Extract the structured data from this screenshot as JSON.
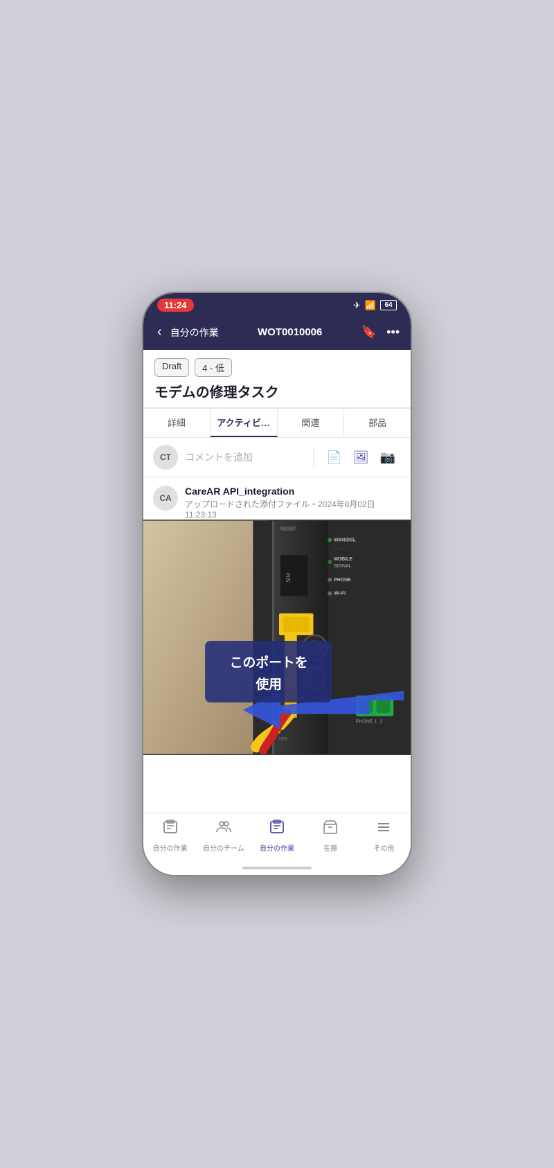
{
  "statusBar": {
    "time": "11:24",
    "batteryLevel": "64"
  },
  "navBar": {
    "backLabel": "自分の作業",
    "workOrderId": "WOT0010006"
  },
  "header": {
    "statusBadge": "Draft",
    "priorityBadge": "4 - 低",
    "title": "モデムの修理タスク"
  },
  "tabs": [
    {
      "label": "詳細",
      "active": false
    },
    {
      "label": "アクティビ…",
      "active": true
    },
    {
      "label": "関連",
      "active": false
    },
    {
      "label": "部品",
      "active": false
    }
  ],
  "commentArea": {
    "avatarText": "CT",
    "placeholder": "コメントを追加"
  },
  "activityItem": {
    "avatarText": "CA",
    "author": "CareAR API_integration",
    "meta": "アップロードされた添付ファイル・2024年8月02日 11:23:13"
  },
  "annotation": {
    "line1": "このポートを",
    "line2": "使用"
  },
  "bottomNav": [
    {
      "label": "自分の作業",
      "icon": "🗂",
      "active": false
    },
    {
      "label": "自分のチーム",
      "icon": "👥",
      "active": false
    },
    {
      "label": "自分の作業",
      "icon": "🗂",
      "active": true
    },
    {
      "label": "在庫",
      "icon": "📦",
      "active": false
    },
    {
      "label": "その他",
      "icon": "☰",
      "active": false
    }
  ]
}
